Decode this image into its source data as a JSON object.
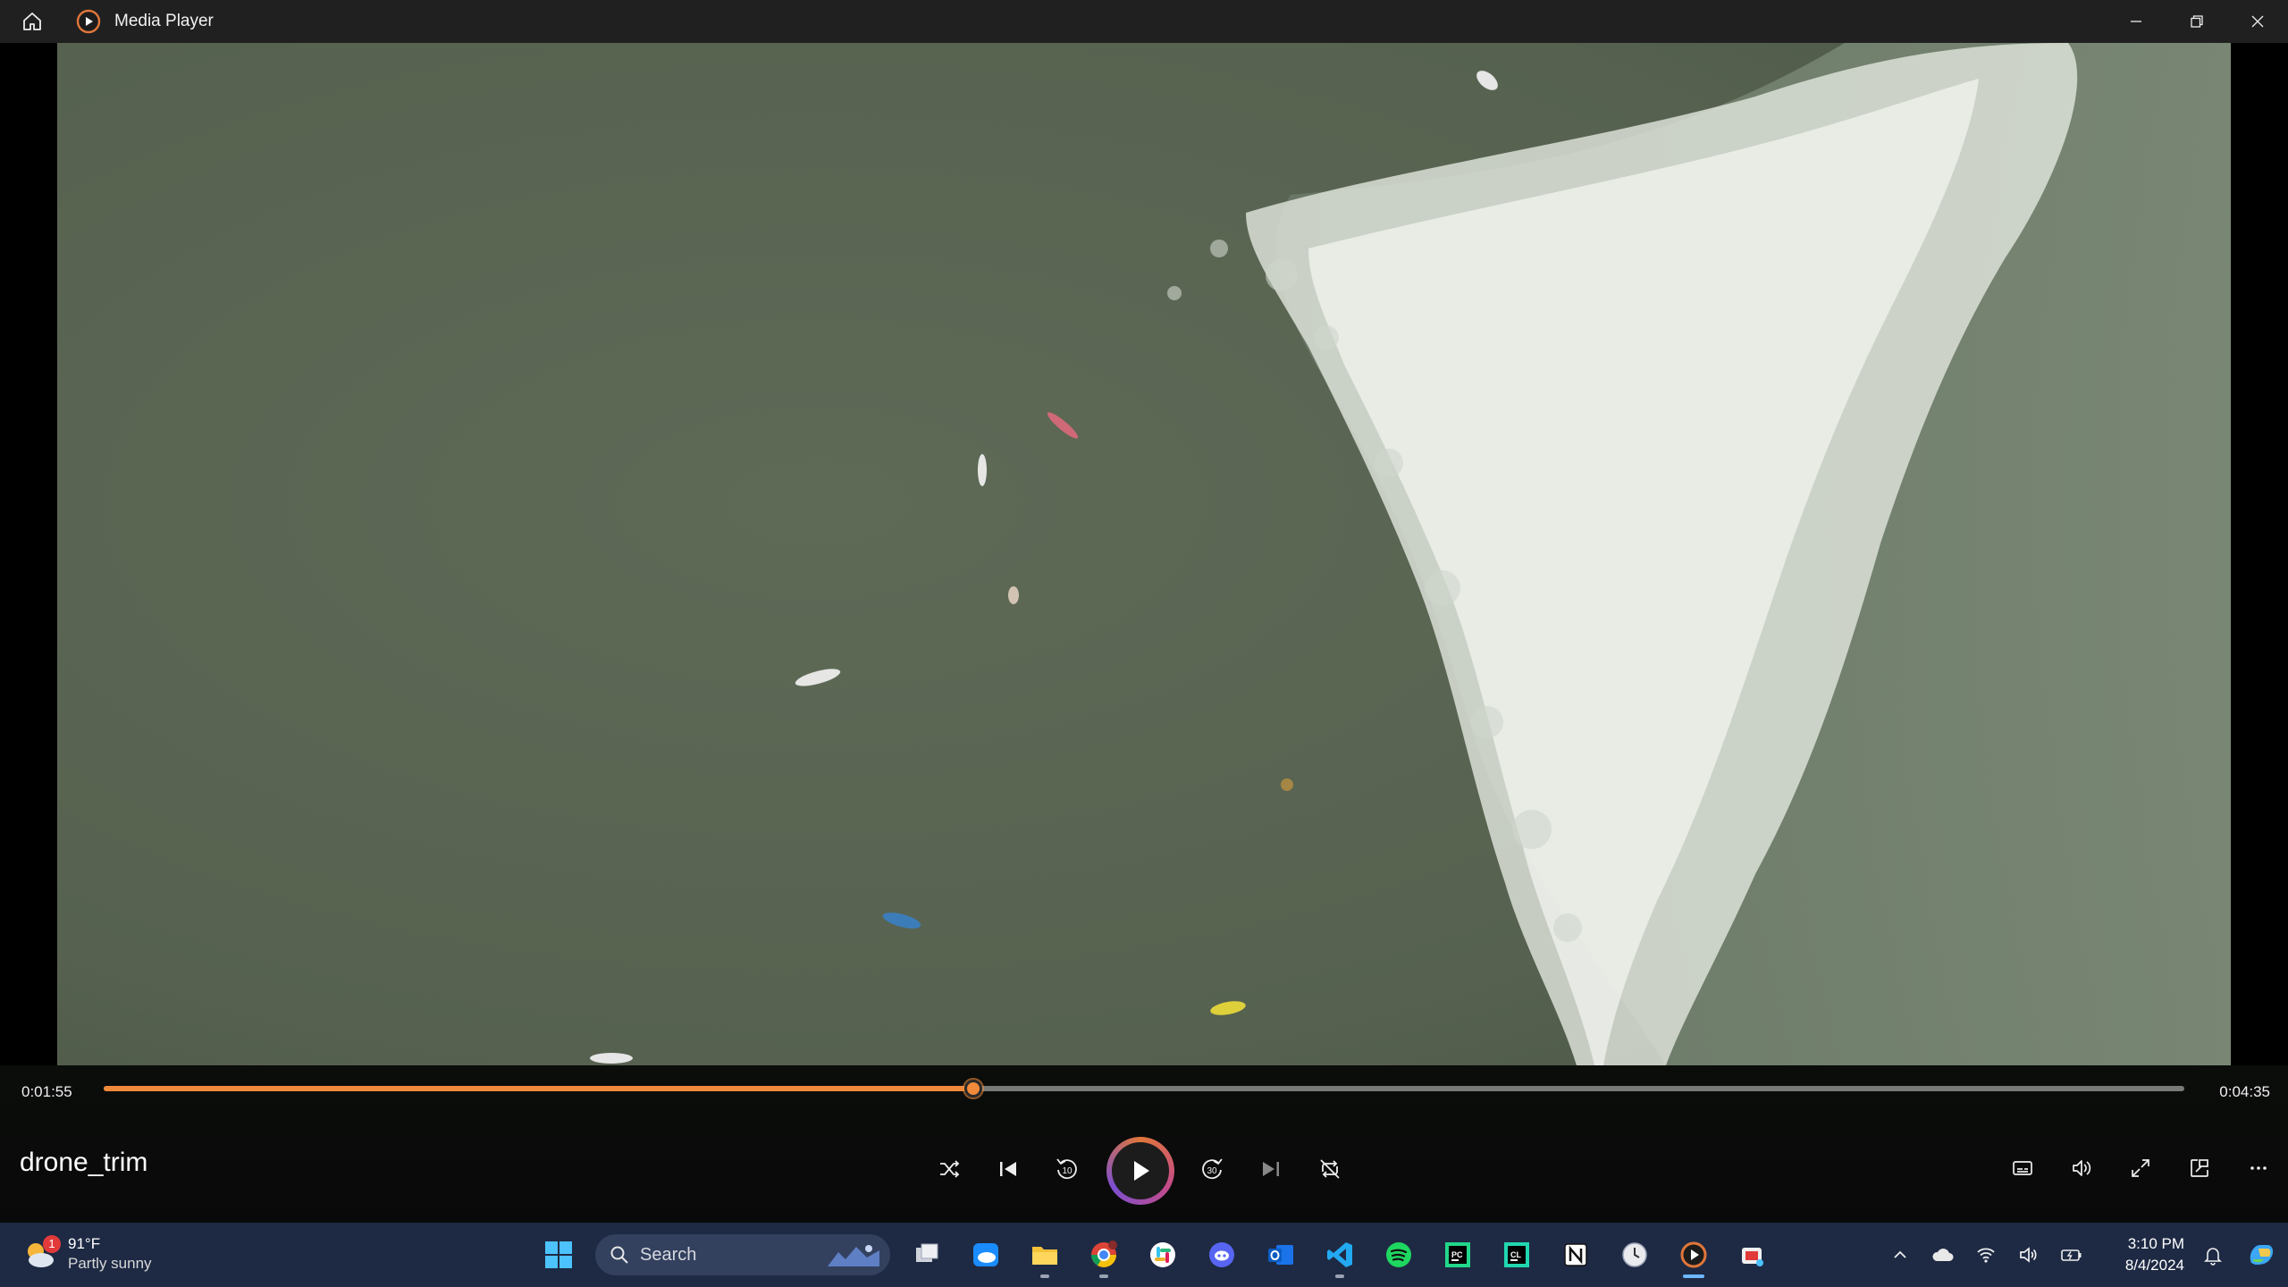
{
  "window": {
    "title": "Media Player",
    "home_icon": "home-icon",
    "app_icon": "media-player-icon",
    "controls": [
      "minimize-icon",
      "restore-icon",
      "close-icon"
    ]
  },
  "player": {
    "media_title": "drone_trim",
    "current_time": "0:01:55",
    "total_time": "0:04:35",
    "progress": 0.418,
    "accent_color": "#f08a3a",
    "center_controls": [
      "shuffle-icon",
      "previous-icon",
      "rewind-10-icon",
      "play-icon",
      "forward-30-icon",
      "next-icon",
      "repeat-off-icon"
    ],
    "right_controls": [
      "captions-icon",
      "volume-icon",
      "fullscreen-icon",
      "mini-player-icon",
      "more-icon"
    ]
  },
  "taskbar": {
    "weather": {
      "temp": "91°F",
      "desc": "Partly sunny",
      "badge": "1"
    },
    "search_placeholder": "Search",
    "apps": [
      "start-icon",
      "search",
      "task-view-icon",
      "onedrive-icon",
      "file-explorer-icon",
      "chrome-icon",
      "slack-icon",
      "discord-icon",
      "outlook-icon",
      "vscode-icon",
      "spotify-icon",
      "pycharm-icon",
      "clion-icon",
      "notion-icon",
      "clock-app-icon",
      "media-player-icon",
      "snipping-tool-icon"
    ],
    "clock": {
      "time": "3:10 PM",
      "date": "8/4/2024"
    },
    "tray": [
      "chevron-up-icon",
      "cloud-icon",
      "wifi-icon",
      "speaker-icon",
      "battery-icon",
      "bell-icon",
      "copilot-icon"
    ]
  }
}
